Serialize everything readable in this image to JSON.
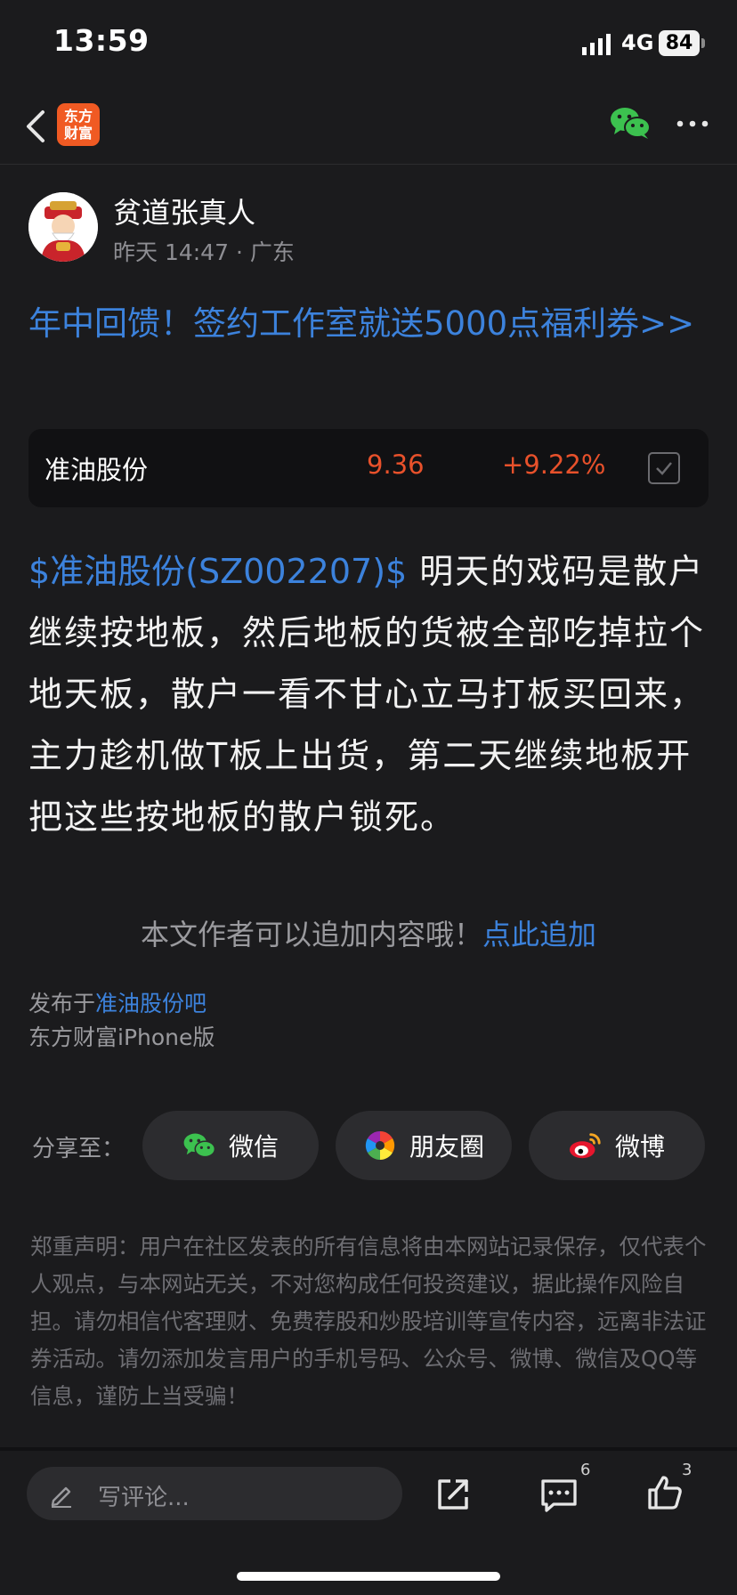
{
  "status_bar": {
    "time": "13:59",
    "network": "4G",
    "battery": "84"
  },
  "nav": {
    "logo_line1": "东方",
    "logo_line2": "财富",
    "back_icon": "chevron-left-icon",
    "wechat_icon": "wechat-icon",
    "more_icon": "more-dots-icon"
  },
  "author": {
    "name": "贫道张真人",
    "meta": "昨天 14:47 · 广东"
  },
  "promo": {
    "text": "年中回馈！签约工作室就送5000点福利券>>"
  },
  "stock": {
    "name": "准油股份",
    "price": "9.36",
    "change": "+9.22%"
  },
  "post": {
    "link": "$准油股份(SZ002207)$",
    "text": " 明天的戏码是散户继续按地板，然后地板的货被全部吃掉拉个地天板，散户一看不甘心立马打板买回来，主力趁机做T板上出货，第二天继续地板开把这些按地板的散户锁死。"
  },
  "append": {
    "prompt": "本文作者可以追加内容哦！",
    "link": "点此追加"
  },
  "published": {
    "prefix": "发布于",
    "forum": "准油股份吧",
    "client": "东方财富iPhone版"
  },
  "share": {
    "label": "分享至：",
    "wechat": "微信",
    "moments": "朋友圈",
    "weibo": "微博"
  },
  "disclaimer": "郑重声明：用户在社区发表的所有信息将由本网站记录保存，仅代表个人观点，与本网站无关，不对您构成任何投资建议，据此操作风险自担。请勿相信代客理财、免费荐股和炒股培训等宣传内容，远离非法证券活动。请勿添加发言用户的手机号码、公众号、微博、微信及QQ等信息，谨防上当受骗！",
  "bottom_bar": {
    "comment_placeholder": "写评论...",
    "comment_count": "6",
    "like_count": "3"
  },
  "colors": {
    "link": "#3c82dc",
    "up": "#e8512b",
    "background": "#1b1b1d",
    "brand": "#f05a23"
  }
}
